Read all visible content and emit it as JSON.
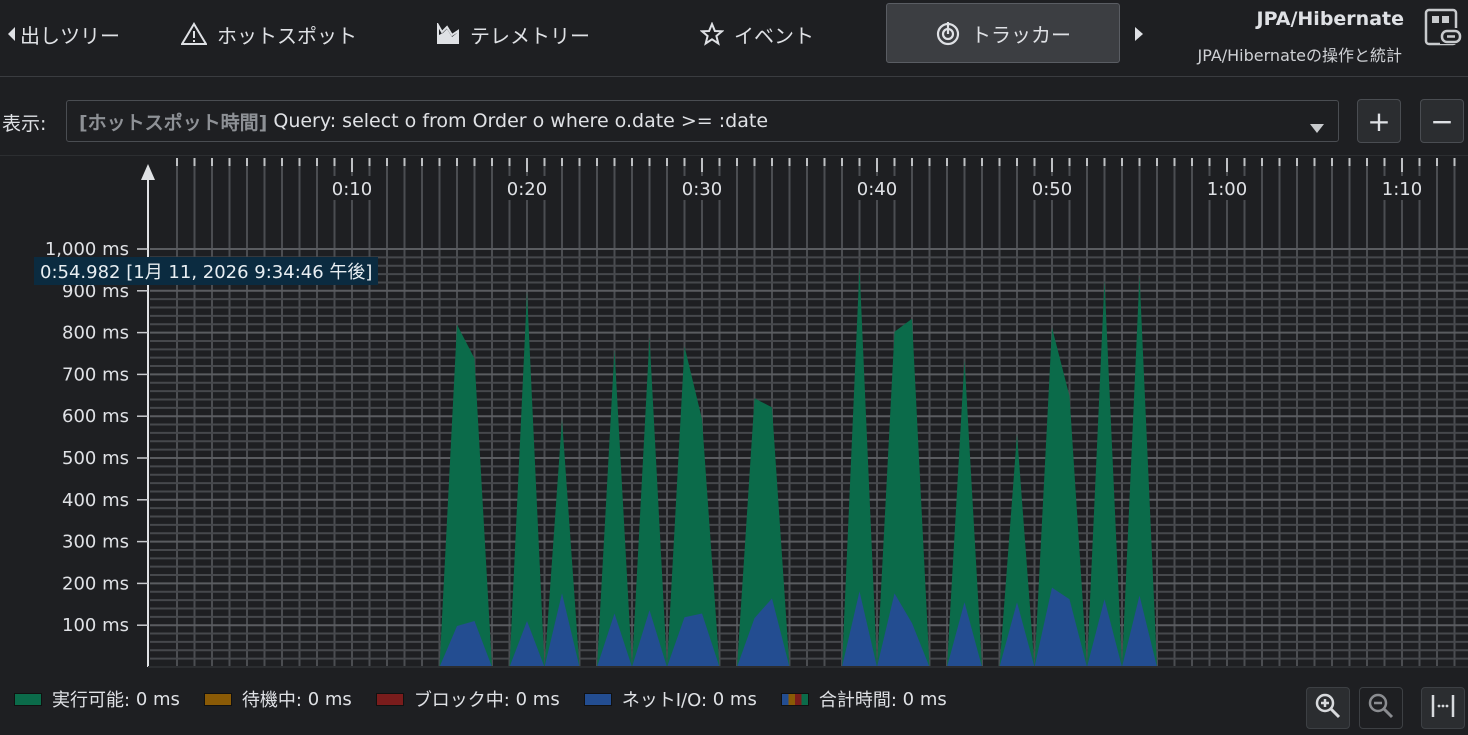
{
  "tabs": [
    {
      "label": "出しツリー",
      "icon": "caret-left-icon"
    },
    {
      "label": "ホットスポット",
      "icon": "warning-icon"
    },
    {
      "label": "テレメトリー",
      "icon": "telemetry-icon"
    },
    {
      "label": "イベント",
      "icon": "star-icon"
    },
    {
      "label": "トラッカー",
      "icon": "tracker-icon",
      "active": true
    }
  ],
  "header": {
    "title": "JPA/Hibernate",
    "subtitle": "JPA/Hibernateの操作と統計"
  },
  "view": {
    "label": "表示:",
    "prefix": "[ホットスポット時間]",
    "value": "Query: select o from Order o where o.date >= :date",
    "add": "+",
    "remove": "−"
  },
  "tooltip": "0:54.982 [1月 11, 2026 9:34:46 午後]",
  "legend": [
    {
      "label": "実行可能:",
      "value": "0 ms",
      "color": "#0b6b4a"
    },
    {
      "label": "待機中:",
      "value": "0 ms",
      "color": "#8a5a06"
    },
    {
      "label": "ブロック中:",
      "value": "0 ms",
      "color": "#7a1c1c"
    },
    {
      "label": "ネットI/O:",
      "value": "0 ms",
      "color": "#234d91"
    },
    {
      "label": "合計時間:",
      "value": "0 ms",
      "color": "multi"
    }
  ],
  "chart_data": {
    "type": "area",
    "stacked": true,
    "xlabel": "",
    "ylabel": "",
    "x_unit": "seconds",
    "xlim": [
      0,
      73
    ],
    "ylim": [
      0,
      1000
    ],
    "x_ticks": [
      {
        "value": 10,
        "label": "0:10"
      },
      {
        "value": 20,
        "label": "0:20"
      },
      {
        "value": 30,
        "label": "0:30"
      },
      {
        "value": 40,
        "label": "0:40"
      },
      {
        "value": 50,
        "label": "0:50"
      },
      {
        "value": 60,
        "label": "1:00"
      },
      {
        "value": 70,
        "label": "1:10"
      }
    ],
    "y_ticks": [
      {
        "value": 100,
        "label": "100 ms"
      },
      {
        "value": 200,
        "label": "200 ms"
      },
      {
        "value": 300,
        "label": "300 ms"
      },
      {
        "value": 400,
        "label": "400 ms"
      },
      {
        "value": 500,
        "label": "500 ms"
      },
      {
        "value": 600,
        "label": "600 ms"
      },
      {
        "value": 700,
        "label": "700 ms"
      },
      {
        "value": 800,
        "label": "800 ms"
      },
      {
        "value": 900,
        "label": "900 ms"
      },
      {
        "value": 1000,
        "label": "1,000 ms"
      }
    ],
    "x": [
      15,
      16,
      17,
      18,
      19,
      20,
      21,
      22,
      23,
      24,
      25,
      26,
      27,
      28,
      29,
      30,
      31,
      32,
      33,
      34,
      35,
      36,
      37,
      38,
      39,
      40,
      41,
      42,
      43,
      44,
      45,
      46,
      47,
      48,
      49,
      50,
      51,
      52,
      53,
      54,
      55,
      56
    ],
    "series": [
      {
        "name": "ネットI/O",
        "color": "#234d91",
        "values": [
          0,
          98,
          110,
          0,
          0,
          110,
          0,
          176,
          0,
          0,
          128,
          0,
          136,
          0,
          119,
          128,
          0,
          0,
          117,
          164,
          0,
          0,
          0,
          0,
          181,
          0,
          176,
          105,
          0,
          0,
          155,
          0,
          0,
          155,
          0,
          190,
          162,
          0,
          162,
          0,
          171,
          0
        ]
      },
      {
        "name": "実行可能",
        "color": "#0b6b4a",
        "values": [
          0,
          721,
          628,
          0,
          0,
          788,
          0,
          417,
          0,
          0,
          632,
          0,
          654,
          0,
          648,
          465,
          0,
          0,
          526,
          457,
          0,
          0,
          0,
          0,
          776,
          0,
          626,
          728,
          0,
          0,
          581,
          0,
          0,
          402,
          0,
          622,
          486,
          0,
          764,
          0,
          767,
          0
        ]
      }
    ],
    "legend": "bottom-left",
    "grid": true
  }
}
